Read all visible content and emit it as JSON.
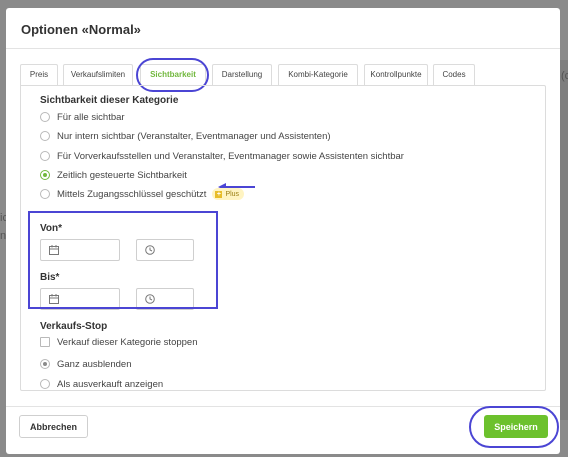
{
  "background": {
    "fragments": [
      "ic",
      "n e",
      "(c"
    ]
  },
  "modal": {
    "title": "Optionen «Normal»",
    "tabs": [
      {
        "label": "Preis",
        "active": false
      },
      {
        "label": "Verkaufslimiten",
        "active": false
      },
      {
        "label": "Sichtbarkeit",
        "active": true
      },
      {
        "label": "Darstellung",
        "active": false
      },
      {
        "label": "Kombi-Kategorie",
        "active": false
      },
      {
        "label": "Kontrollpunkte",
        "active": false
      },
      {
        "label": "Codes",
        "active": false
      }
    ],
    "visibility": {
      "heading": "Sichtbarkeit dieser Kategorie",
      "options": [
        {
          "label": "Für alle sichtbar",
          "selected": false
        },
        {
          "label": "Nur intern sichtbar (Veranstalter, Eventmanager und Assistenten)",
          "selected": false
        },
        {
          "label": "Für Vorverkaufsstellen und Veranstalter, Eventmanager sowie Assistenten sichtbar",
          "selected": false
        },
        {
          "label": "Zeitlich gesteuerte Sichtbarkeit",
          "selected": true
        },
        {
          "label": "Mittels Zugangsschlüssel geschützt",
          "selected": false,
          "badge": "Plus"
        }
      ]
    },
    "von": {
      "label": "Von*",
      "date_value": "",
      "time_value": ""
    },
    "bis": {
      "label": "Bis*",
      "date_value": "",
      "time_value": ""
    },
    "sales_stop": {
      "heading": "Verkaufs-Stop",
      "checkbox_label": "Verkauf dieser Kategorie stoppen",
      "checked": false,
      "options": [
        {
          "label": "Ganz ausblenden",
          "selected": true
        },
        {
          "label": "Als ausverkauft anzeigen",
          "selected": false
        }
      ]
    },
    "footer": {
      "cancel_label": "Abbrechen",
      "save_label": "Speichern"
    }
  },
  "colors": {
    "accent_green": "#6cc12d",
    "annotation_blue": "#4b45d4"
  }
}
